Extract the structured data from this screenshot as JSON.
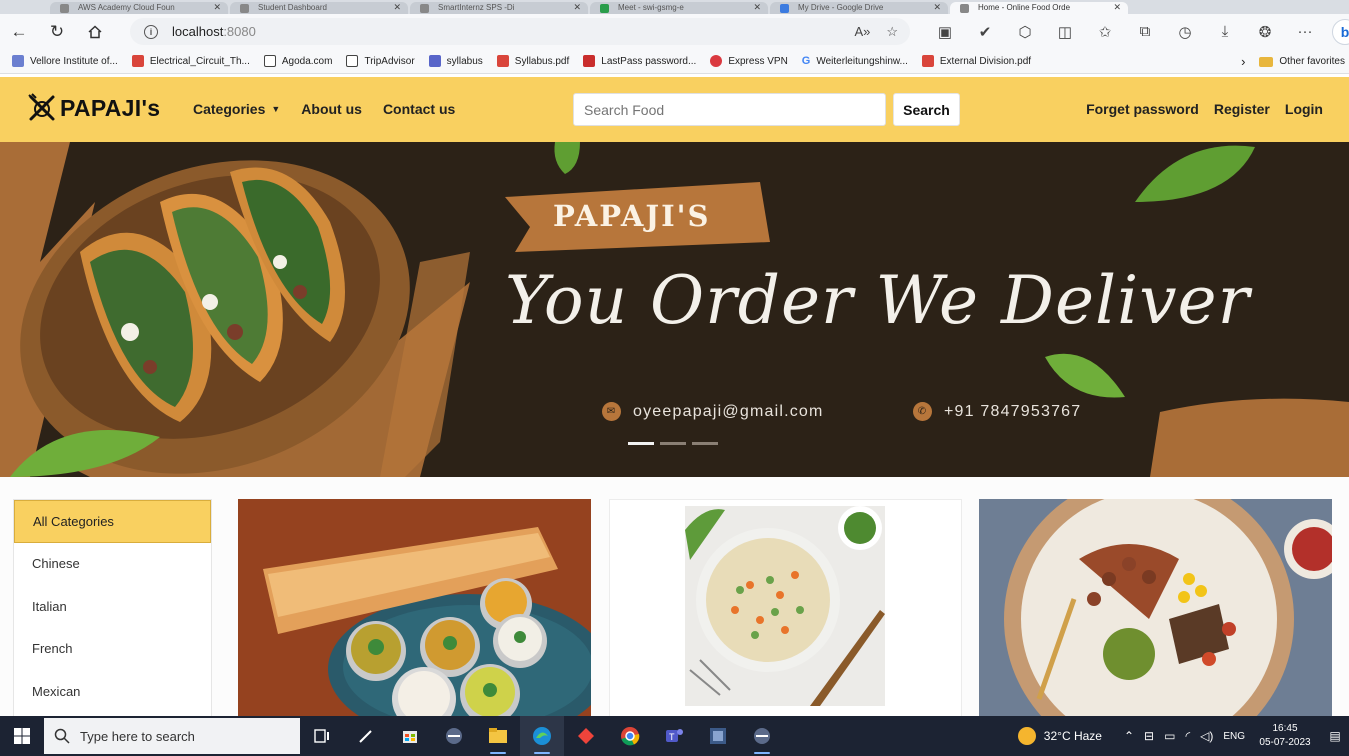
{
  "browser": {
    "tabs": [
      {
        "label": "AWS Academy Cloud Foun"
      },
      {
        "label": "Student Dashboard"
      },
      {
        "label": "SmartInternz SPS -Di"
      },
      {
        "label": "Meet - swi-gsmg-e"
      },
      {
        "label": "My Drive - Google Drive"
      },
      {
        "label": "Home - Online Food Orde"
      }
    ],
    "url_host": "localhost",
    "url_port": ":8080",
    "bookmarks": [
      {
        "label": "Vellore Institute of...",
        "color": "#6b7fd0"
      },
      {
        "label": "Electrical_Circuit_Th...",
        "color": "#d9453b"
      },
      {
        "label": "Agoda.com",
        "color": "#444444"
      },
      {
        "label": "TripAdvisor",
        "color": "#444444"
      },
      {
        "label": "syllabus",
        "color": "#5865c9"
      },
      {
        "label": "Syllabus.pdf",
        "color": "#d9453b"
      },
      {
        "label": "LastPass password...",
        "color": "#c92d2d"
      },
      {
        "label": "Express VPN",
        "color": "#da3940"
      },
      {
        "label": "Weiterleitungshinw...",
        "color": "#4285f4"
      },
      {
        "label": "External Division.pdf",
        "color": "#d9453b"
      }
    ],
    "other_favorites": "Other favorites"
  },
  "site": {
    "brand": "PAPAJI's",
    "nav": {
      "categories": "Categories",
      "about": "About us",
      "contact": "Contact us"
    },
    "search": {
      "placeholder": "Search Food",
      "button": "Search"
    },
    "account": {
      "forget_password": "Forget password",
      "register": "Register",
      "login": "Login"
    },
    "hero": {
      "brand": "PAPAJI'S",
      "tagline": "You Order We Deliver",
      "email": "oyeepapaji@gmail.com",
      "phone": "+91 7847953767",
      "slides": 3,
      "active_slide": 1
    },
    "categories": [
      {
        "label": "All Categories",
        "active": true
      },
      {
        "label": "Chinese",
        "active": false
      },
      {
        "label": "Italian",
        "active": false
      },
      {
        "label": "French",
        "active": false
      },
      {
        "label": "Mexican",
        "active": false
      }
    ],
    "colors": {
      "accent": "#f9d060",
      "hero_bg": "#2c2217",
      "brush": "#b7763b"
    }
  },
  "taskbar": {
    "search_placeholder": "Type here to search",
    "weather": "32°C  Haze",
    "language": "ENG",
    "time": "16:45",
    "date": "05-07-2023"
  }
}
